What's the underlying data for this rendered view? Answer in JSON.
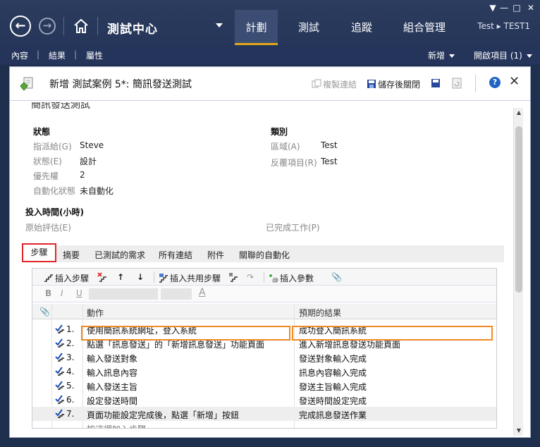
{
  "window_controls": [
    "▼",
    "—",
    "□",
    "✕"
  ],
  "nav": {
    "back_icon": "back-arrow-icon",
    "forward_icon": "forward-arrow-icon",
    "home_icon": "home-icon"
  },
  "app_title": "測試中心",
  "tabs": [
    {
      "label": "計劃",
      "active": true
    },
    {
      "label": "測試",
      "active": false
    },
    {
      "label": "追蹤",
      "active": false
    },
    {
      "label": "組合管理",
      "active": false
    }
  ],
  "user": "Test ▸ TEST1",
  "subnav": {
    "items": [
      "內容",
      "結果",
      "屬性"
    ],
    "new_label": "新增",
    "open_items_label": "開啟項目 (1)"
  },
  "work_item": {
    "title": "新增 測試案例 5*: 簡訊發送測試",
    "copy_link": "複製連結",
    "save_close": "儲存後關閉",
    "top_cut_text": "簡訊發送測試",
    "status_section": "狀態",
    "category_section": "類別",
    "fields_left": [
      {
        "label": "指派給(G)",
        "value": "Steve"
      },
      {
        "label": "狀態(E)",
        "value": "設計"
      },
      {
        "label": "優先權",
        "value": "2"
      },
      {
        "label": "自動化狀態",
        "value": "未自動化"
      }
    ],
    "fields_right": [
      {
        "label": "區域(A)",
        "value": "Test"
      },
      {
        "label": "反覆項目(R)",
        "value": "Test"
      }
    ],
    "hours_section": "投入時間(小時)",
    "original_estimate": "原始評估(E)",
    "completed_work": "已完成工作(P)"
  },
  "form_tabs": [
    "步驟",
    "摘要",
    "已測試的需求",
    "所有連結",
    "附件",
    "關聯的自動化"
  ],
  "steps_toolbar": {
    "insert_step": "插入步驟",
    "insert_shared": "插入共用步驟",
    "insert_param": "插入參數"
  },
  "format_bar": {
    "bold": "B",
    "italic": "I",
    "underline": "U",
    "font_color": "A"
  },
  "grid": {
    "col_action": "動作",
    "col_expected": "預期的結果",
    "rows": [
      {
        "num": "1.",
        "action": "使用簡訊系統網址，登入系統",
        "expected": "成功登入簡訊系統"
      },
      {
        "num": "2.",
        "action": "點選「訊息發送」的「新增訊息發送」功能頁面",
        "expected": "進入新增訊息發送功能頁面"
      },
      {
        "num": "3.",
        "action": "輸入發送對象",
        "expected": "發送對象輸入完成"
      },
      {
        "num": "4.",
        "action": "輸入訊息內容",
        "expected": "訊息內容輸入完成"
      },
      {
        "num": "5.",
        "action": "輸入發送主旨",
        "expected": "發送主旨輸入完成"
      },
      {
        "num": "6.",
        "action": "設定發送時間",
        "expected": "發送時間設定完成"
      },
      {
        "num": "7.",
        "action": "頁面功能設定完成後，點選「新增」按鈕",
        "expected": "完成訊息發送作業"
      },
      {
        "num": "",
        "action": "按這裡加入步驟",
        "expected": ""
      }
    ]
  },
  "colors": {
    "accent": "#e2a51a",
    "highlight_tab": "#e0252b",
    "highlight_row": "#f08a24",
    "chrome": "#26365a"
  }
}
